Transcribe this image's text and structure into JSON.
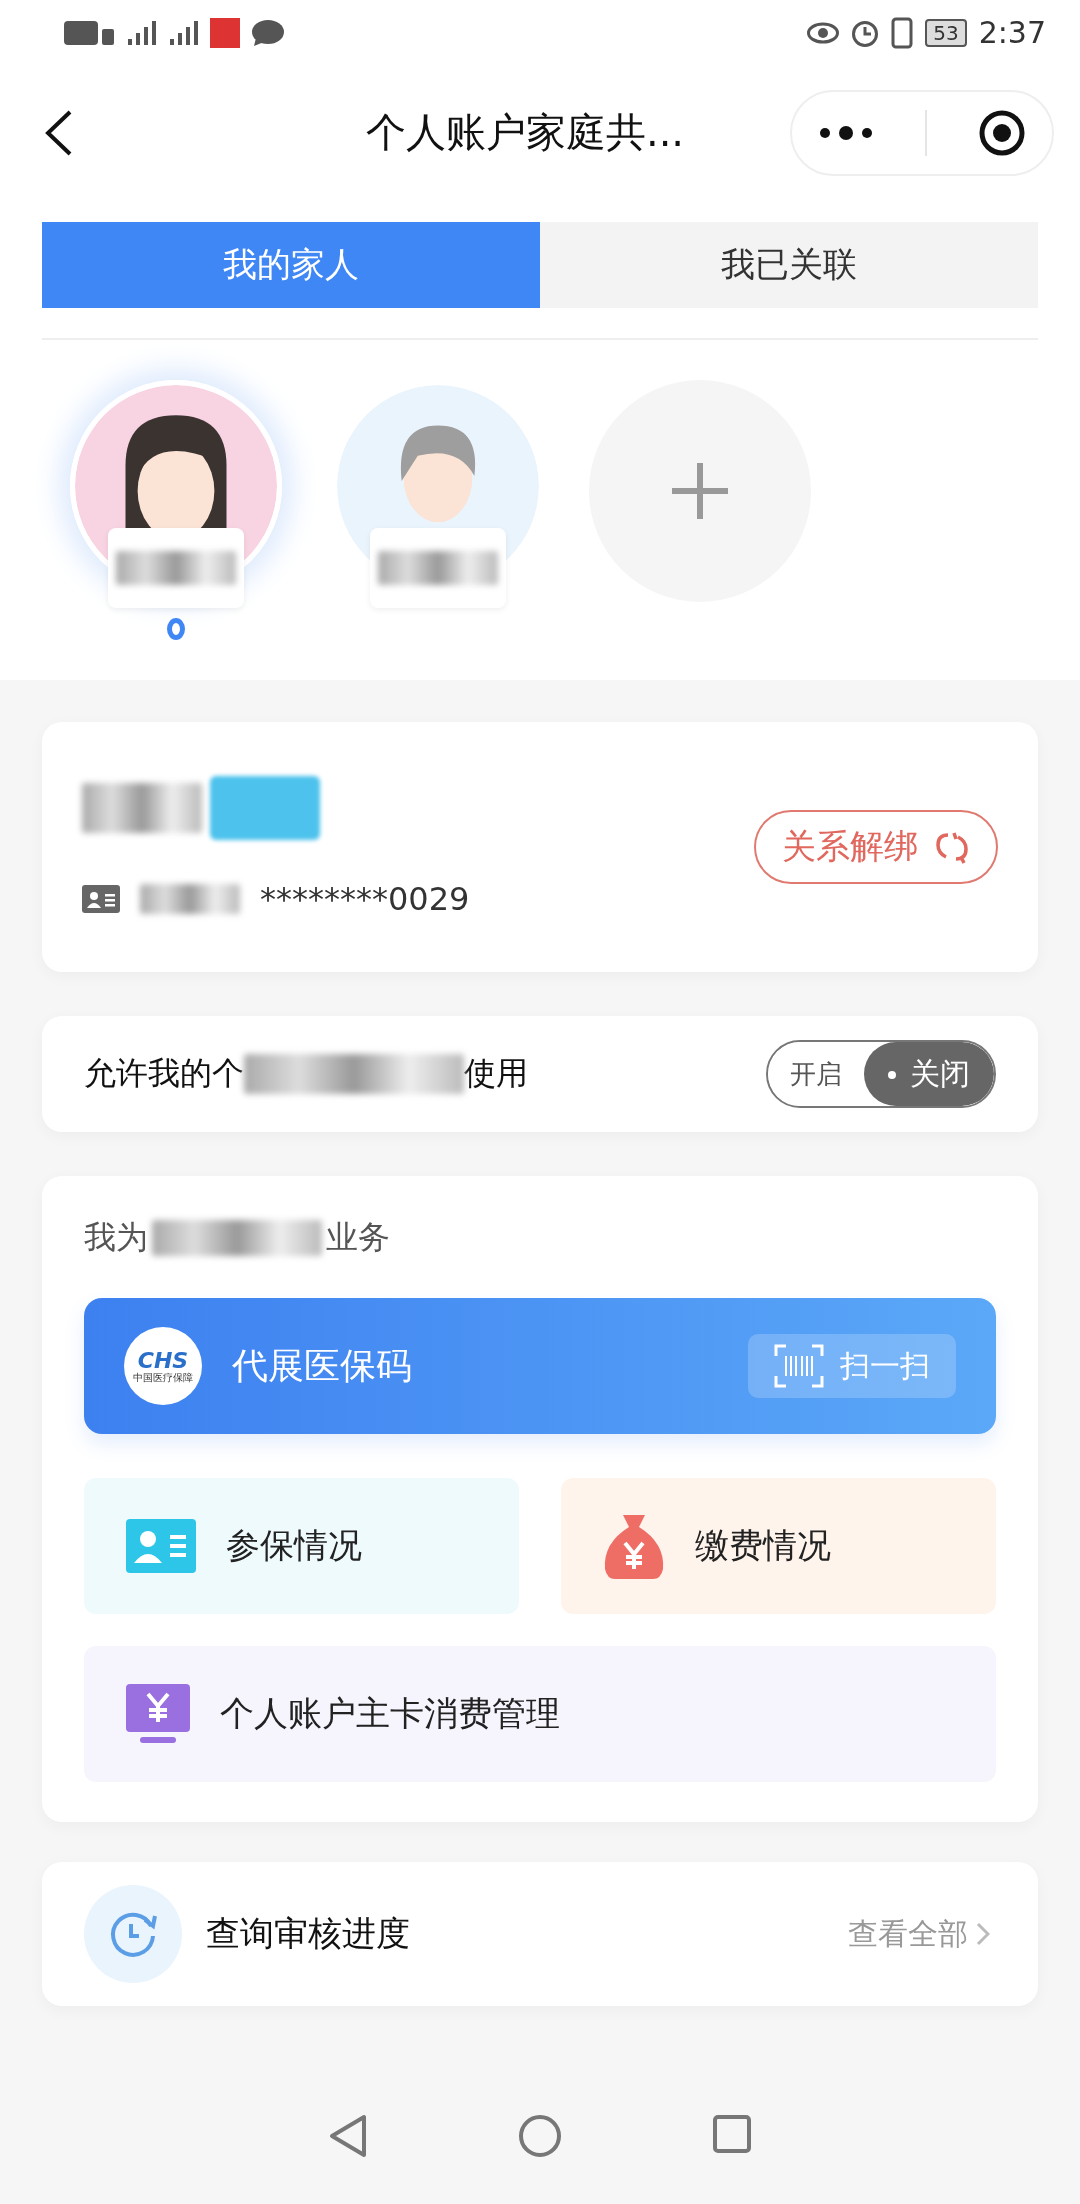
{
  "status_bar": {
    "time": "2:37",
    "battery": "53"
  },
  "header": {
    "title": "个人账户家庭共..."
  },
  "tabs": [
    {
      "label": "我的家人",
      "selected": true
    },
    {
      "label": "我已关联",
      "selected": false
    }
  ],
  "members": [
    {
      "kind": "female",
      "selected": true
    },
    {
      "kind": "male",
      "selected": false
    },
    {
      "kind": "add",
      "selected": false
    }
  ],
  "member_card": {
    "id_number": "********0029",
    "unbind_button": "关系解绑"
  },
  "permission": {
    "label_start": "允许我的个",
    "label_end": "使用",
    "options": [
      {
        "label": "开启",
        "selected": false
      },
      {
        "label": "关闭",
        "selected": true
      }
    ]
  },
  "services": {
    "title_start": "我为",
    "title_end": "业务",
    "code_banner": {
      "label": "代展医保码",
      "logo": "CHS",
      "logo_caption": "中国医疗保障",
      "scan": "扫一扫"
    },
    "tiles": [
      {
        "kind": "insurance",
        "label": "参保情况"
      },
      {
        "kind": "payment",
        "label": "缴费情况"
      },
      {
        "kind": "account",
        "label": "个人账户主卡消费管理"
      }
    ]
  },
  "progress": {
    "label": "查询审核进度",
    "link": "查看全部"
  }
}
